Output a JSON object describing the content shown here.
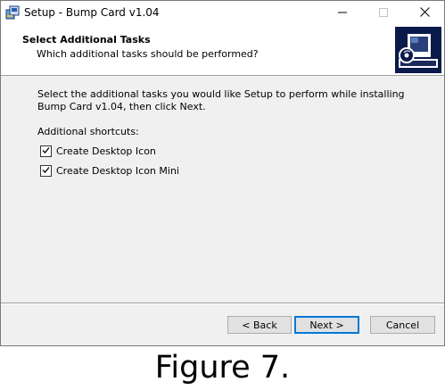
{
  "window": {
    "title": "Setup - Bump Card v1.04",
    "controls": {
      "minimize": "minimize",
      "maximize": "maximize",
      "close": "close"
    }
  },
  "header": {
    "title": "Select Additional Tasks",
    "subtitle": "Which additional tasks should be performed?"
  },
  "content": {
    "description": "Select the additional tasks you would like Setup to perform while installing Bump Card v1.04, then click Next.",
    "group_label": "Additional shortcuts:",
    "tasks": [
      {
        "label": "Create Desktop Icon",
        "checked": true
      },
      {
        "label": "Create Desktop Icon Mini",
        "checked": true
      }
    ]
  },
  "buttons": {
    "back": "< Back",
    "next": "Next >",
    "cancel": "Cancel"
  },
  "caption": "Figure 7.",
  "colors": {
    "accent": "#0078d7",
    "wizard_image_bg": "#0a1a4a",
    "dialog_bg": "#f0f0f0"
  },
  "icons": [
    "installer-app-icon",
    "minimize-icon",
    "maximize-icon",
    "close-icon",
    "computer-disc-icon",
    "checkmark-icon"
  ]
}
